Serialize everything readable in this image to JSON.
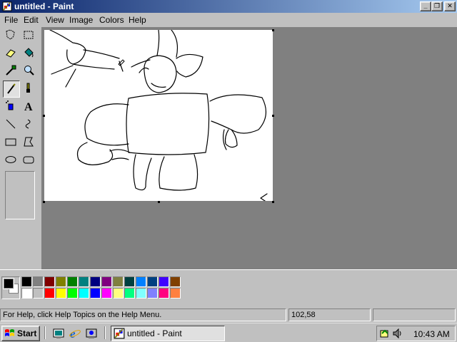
{
  "window": {
    "title": "untitled - Paint",
    "minimize": "_",
    "restore": "❐",
    "close": "✕"
  },
  "menu": [
    "File",
    "Edit",
    "View",
    "Image",
    "Colors",
    "Help"
  ],
  "tools": [
    {
      "name": "free-form-select-tool",
      "icon": "free-form-select-icon"
    },
    {
      "name": "select-tool",
      "icon": "select-icon"
    },
    {
      "name": "eraser-tool",
      "icon": "eraser-icon"
    },
    {
      "name": "fill-tool",
      "icon": "fill-bucket-icon"
    },
    {
      "name": "pick-color-tool",
      "icon": "eyedropper-icon"
    },
    {
      "name": "magnifier-tool",
      "icon": "magnifier-icon"
    },
    {
      "name": "pencil-tool",
      "icon": "pencil-icon",
      "active": true
    },
    {
      "name": "brush-tool",
      "icon": "brush-icon"
    },
    {
      "name": "airbrush-tool",
      "icon": "airbrush-icon"
    },
    {
      "name": "text-tool",
      "icon": "text-icon",
      "glyph": "A"
    },
    {
      "name": "line-tool",
      "icon": "line-icon"
    },
    {
      "name": "curve-tool",
      "icon": "curve-icon"
    },
    {
      "name": "rectangle-tool",
      "icon": "rectangle-icon"
    },
    {
      "name": "polygon-tool",
      "icon": "polygon-icon"
    },
    {
      "name": "ellipse-tool",
      "icon": "ellipse-icon"
    },
    {
      "name": "rounded-rectangle-tool",
      "icon": "rounded-rectangle-icon"
    }
  ],
  "colors": {
    "foreground": "#000000",
    "background": "#ffffff",
    "palette_top": [
      "#000000",
      "#808080",
      "#800000",
      "#808000",
      "#008000",
      "#008080",
      "#000080",
      "#800080",
      "#808040",
      "#004040",
      "#0080ff",
      "#004080",
      "#4000ff",
      "#804000"
    ],
    "palette_bottom": [
      "#ffffff",
      "#c0c0c0",
      "#ff0000",
      "#ffff00",
      "#00ff00",
      "#00ffff",
      "#0000ff",
      "#ff00ff",
      "#ffff80",
      "#00ff80",
      "#80ffff",
      "#8080ff",
      "#ff0080",
      "#ff8040"
    ]
  },
  "status": {
    "help": "For Help, click Help Topics on the Help Menu.",
    "coords": "102,58",
    "size": ""
  },
  "taskbar": {
    "start": "Start",
    "task": "untitled - Paint",
    "clock": "10:43 AM",
    "quick_launch": [
      "show-desktop-icon",
      "internet-explorer-icon",
      "channels-icon"
    ]
  }
}
